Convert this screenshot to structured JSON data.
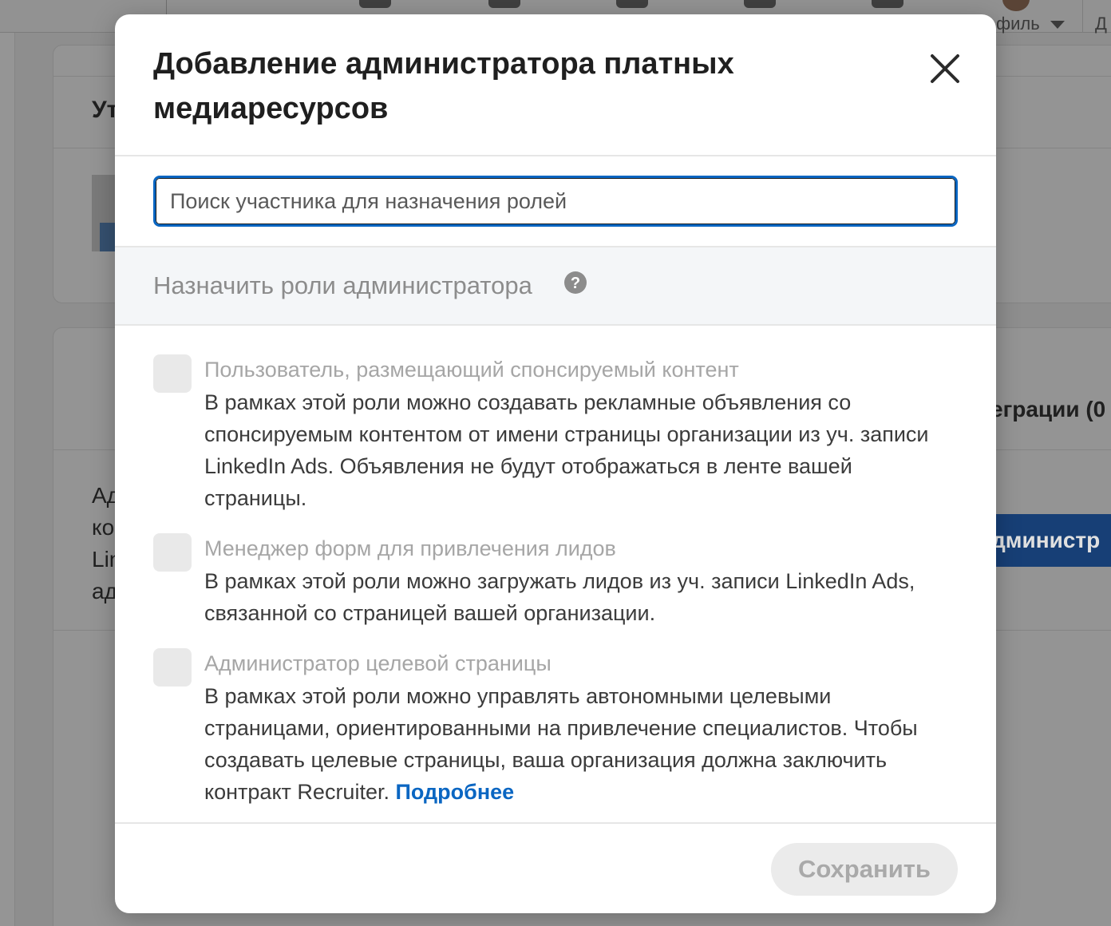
{
  "background": {
    "profile_label": "филь",
    "more_label": "Д",
    "card1_heading": "Ут",
    "card2_right_text": "еграции (0",
    "card3_lines": [
      "Ад",
      "ко",
      "Lin",
      "ад"
    ],
    "blue_button_label": "дминистр"
  },
  "modal": {
    "title": "Добавление администратора платных медиаресурсов",
    "search": {
      "placeholder": "Поиск участника для назначения ролей",
      "value": ""
    },
    "assign_roles_label": "Назначить роли администратора",
    "roles": [
      {
        "title": "Пользователь, размещающий спонсируемый контент",
        "description": "В рамках этой роли можно создавать рекламные объявления со спонсируемым контентом от имени страницы организации из уч. записи LinkedIn Ads. Объявления не будут отображаться в ленте вашей страницы.",
        "checked": false
      },
      {
        "title": "Менеджер форм для привлечения лидов",
        "description": "В рамках этой роли можно загружать лидов из уч. записи LinkedIn Ads, связанной со страницей вашей организации.",
        "checked": false
      },
      {
        "title": "Администратор целевой страницы",
        "description": "В рамках этой роли можно управлять автономными целевыми страницами, ориентированными на привлечение специалистов. Чтобы создавать целевые страницы, ваша организация должна заключить контракт Recruiter.",
        "link_text": "Подробнее",
        "checked": false
      }
    ],
    "save_label": "Сохранить"
  },
  "colors": {
    "accent": "#0a66c2",
    "overlay": "#8e8e8e",
    "disabled_button_bg": "#ebebeb",
    "disabled_button_text": "#a9a9a9"
  },
  "icons": {
    "close": "close-icon",
    "help": "help-icon"
  }
}
